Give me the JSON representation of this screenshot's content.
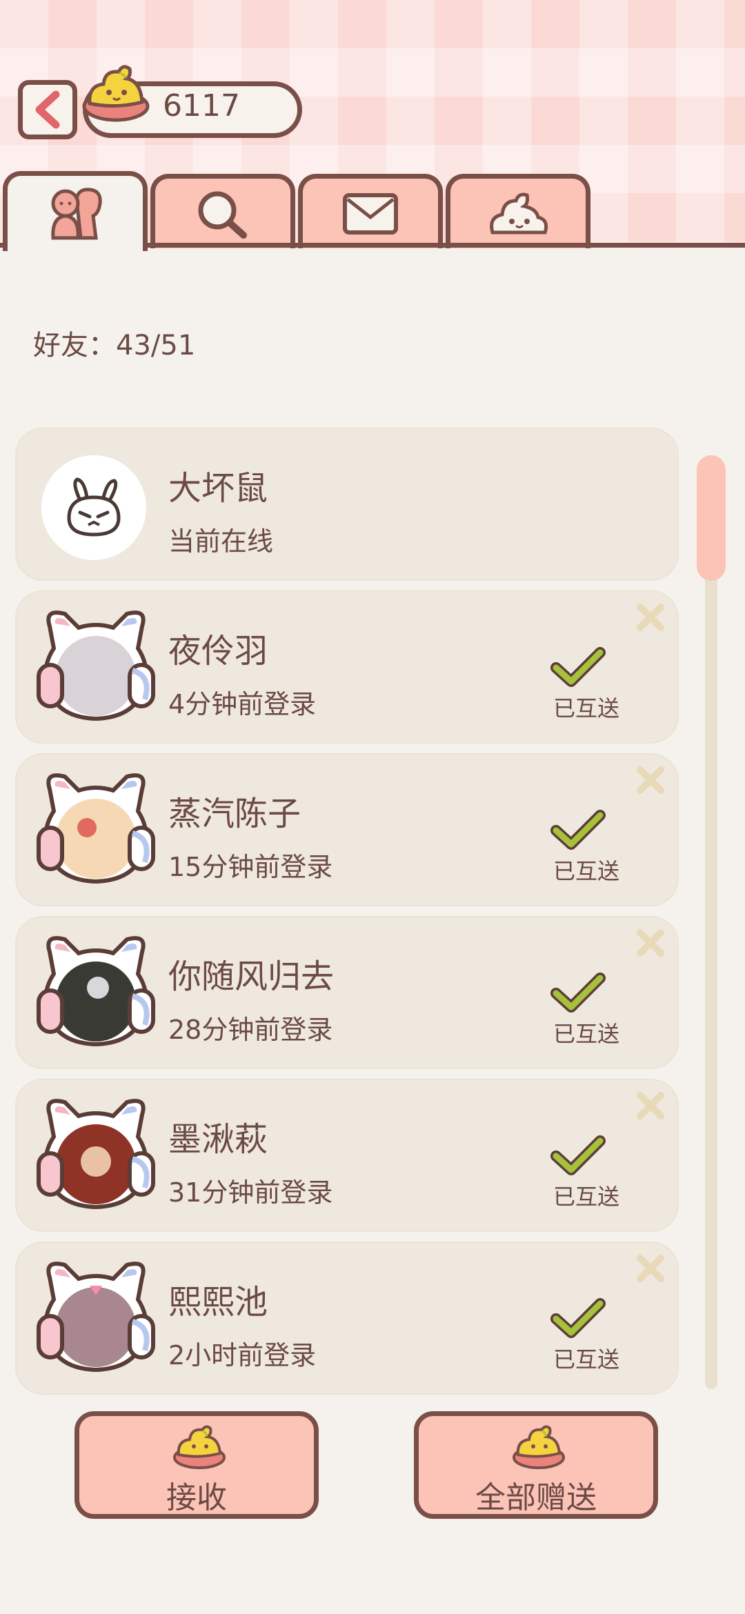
{
  "header": {
    "currency_value": "6117"
  },
  "tabs": [
    {
      "icon": "friends-icon",
      "active": true
    },
    {
      "icon": "search-icon",
      "active": false
    },
    {
      "icon": "mail-icon",
      "active": false
    },
    {
      "icon": "poop-mascot-icon",
      "active": false
    }
  ],
  "friends": {
    "count_label": "好友：43/51"
  },
  "self": {
    "name": "大坏鼠",
    "status": "当前在线"
  },
  "friend_list": [
    {
      "name": "夜伶羽",
      "status": "4分钟前登录",
      "exchange_label": "已互送"
    },
    {
      "name": "蒸汽陈子",
      "status": "15分钟前登录",
      "exchange_label": "已互送"
    },
    {
      "name": "你随风归去",
      "status": "28分钟前登录",
      "exchange_label": "已互送"
    },
    {
      "name": "墨湫萩",
      "status": "31分钟前登录",
      "exchange_label": "已互送"
    },
    {
      "name": "熙熙池",
      "status": "2小时前登录",
      "exchange_label": "已互送"
    }
  ],
  "actions": {
    "receive_label": "接收",
    "send_all_label": "全部赠送"
  },
  "colors": {
    "accent_pink": "#fcc3b7",
    "outline_brown": "#7a4f48",
    "check_green": "#a7c23a",
    "background": "#f5f2ed"
  }
}
